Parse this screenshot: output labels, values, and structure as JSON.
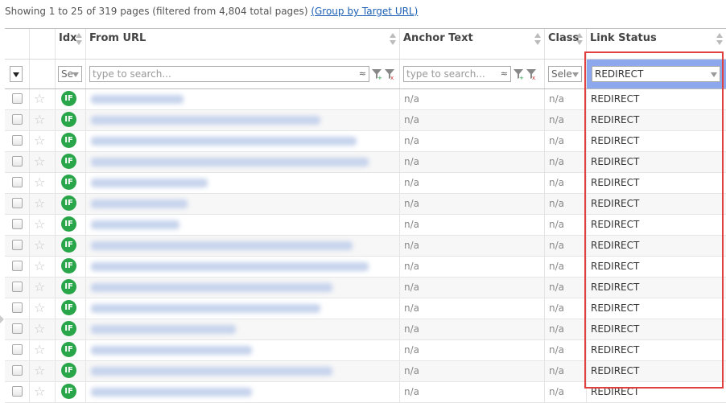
{
  "summary": {
    "text": "Showing 1 to 25 of 319 pages (filtered from 4,804 total pages) ",
    "group_link": "(Group by Target URL)"
  },
  "columns": {
    "idx": "Idx",
    "from_url": "From URL",
    "anchor_text": "Anchor Text",
    "class": "Class",
    "link_status": "Link Status"
  },
  "filters": {
    "idx_select": "Se",
    "from_url_placeholder": "type to search...",
    "anchor_placeholder": "type to search...",
    "class_select": "Sele",
    "link_status_value": "REDIRECT",
    "approx_symbol": "≈"
  },
  "rows": [
    {
      "anchor": "n/a",
      "class": "n/a",
      "status": "REDIRECT",
      "badge": "IF"
    },
    {
      "anchor": "n/a",
      "class": "n/a",
      "status": "REDIRECT",
      "badge": "IF"
    },
    {
      "anchor": "n/a",
      "class": "n/a",
      "status": "REDIRECT",
      "badge": "IF"
    },
    {
      "anchor": "n/a",
      "class": "n/a",
      "status": "REDIRECT",
      "badge": "IF"
    },
    {
      "anchor": "n/a",
      "class": "n/a",
      "status": "REDIRECT",
      "badge": "IF"
    },
    {
      "anchor": "n/a",
      "class": "n/a",
      "status": "REDIRECT",
      "badge": "IF"
    },
    {
      "anchor": "n/a",
      "class": "n/a",
      "status": "REDIRECT",
      "badge": "IF"
    },
    {
      "anchor": "n/a",
      "class": "n/a",
      "status": "REDIRECT",
      "badge": "IF"
    },
    {
      "anchor": "n/a",
      "class": "n/a",
      "status": "REDIRECT",
      "badge": "IF"
    },
    {
      "anchor": "n/a",
      "class": "n/a",
      "status": "REDIRECT",
      "badge": "IF"
    },
    {
      "anchor": "n/a",
      "class": "n/a",
      "status": "REDIRECT",
      "badge": "IF"
    },
    {
      "anchor": "n/a",
      "class": "n/a",
      "status": "REDIRECT",
      "badge": "IF"
    },
    {
      "anchor": "n/a",
      "class": "n/a",
      "status": "REDIRECT",
      "badge": "IF"
    },
    {
      "anchor": "n/a",
      "class": "n/a",
      "status": "REDIRECT",
      "badge": "IF"
    },
    {
      "anchor": "n/a",
      "class": "n/a",
      "status": "REDIRECT",
      "badge": "IF"
    }
  ],
  "colors": {
    "badge_green": "#2aa64a",
    "highlight_red": "#e04040",
    "selected_filter_bg": "#8ea8ee"
  },
  "icons": {
    "star": "star-icon",
    "funnel_add": "filter-add-icon",
    "funnel_clear": "filter-clear-icon",
    "dropdown": "chevron-down-icon"
  }
}
